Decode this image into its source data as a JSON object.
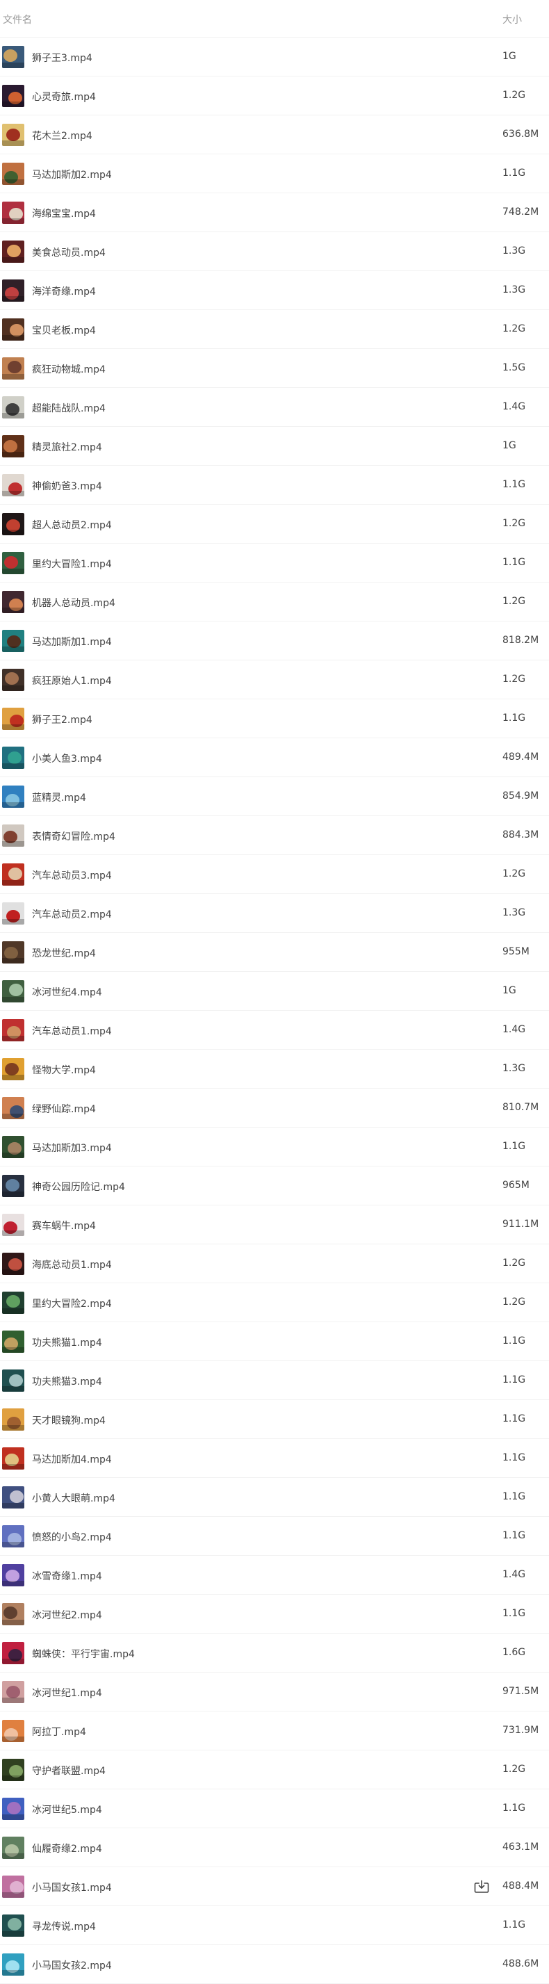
{
  "header": {
    "name_label": "文件名",
    "size_label": "大小"
  },
  "files": [
    {
      "name": "狮子王3.mp4",
      "size": "1G",
      "colors": [
        "#3a5a7a",
        "#c8a060"
      ],
      "icon": "video-thumbnail-icon"
    },
    {
      "name": "心灵奇旅.mp4",
      "size": "1.2G",
      "colors": [
        "#2a1a30",
        "#d06030"
      ],
      "icon": "video-thumbnail-icon"
    },
    {
      "name": "花木兰2.mp4",
      "size": "636.8M",
      "colors": [
        "#e0c070",
        "#a03020"
      ],
      "icon": "video-thumbnail-icon"
    },
    {
      "name": "马达加斯加2.mp4",
      "size": "1.1G",
      "colors": [
        "#c07040",
        "#406030"
      ],
      "icon": "video-thumbnail-icon"
    },
    {
      "name": "海绵宝宝.mp4",
      "size": "748.2M",
      "colors": [
        "#b03040",
        "#e0d0c0"
      ],
      "icon": "video-thumbnail-icon"
    },
    {
      "name": "美食总动员.mp4",
      "size": "1.3G",
      "colors": [
        "#602020",
        "#e0a060"
      ],
      "icon": "video-thumbnail-icon"
    },
    {
      "name": "海洋奇缘.mp4",
      "size": "1.3G",
      "colors": [
        "#302028",
        "#c04040"
      ],
      "icon": "video-thumbnail-icon"
    },
    {
      "name": "宝贝老板.mp4",
      "size": "1.2G",
      "colors": [
        "#503020",
        "#d09060"
      ],
      "icon": "video-thumbnail-icon"
    },
    {
      "name": "疯狂动物城.mp4",
      "size": "1.5G",
      "colors": [
        "#c08050",
        "#704030"
      ],
      "icon": "video-thumbnail-icon"
    },
    {
      "name": "超能陆战队.mp4",
      "size": "1.4G",
      "colors": [
        "#d0d0c8",
        "#404040"
      ],
      "icon": "video-thumbnail-icon"
    },
    {
      "name": "精灵旅社2.mp4",
      "size": "1G",
      "colors": [
        "#603018",
        "#c07040"
      ],
      "icon": "video-thumbnail-icon"
    },
    {
      "name": "神偷奶爸3.mp4",
      "size": "1.1G",
      "colors": [
        "#e0d8d0",
        "#c03030"
      ],
      "icon": "video-thumbnail-icon"
    },
    {
      "name": "超人总动员2.mp4",
      "size": "1.2G",
      "colors": [
        "#201818",
        "#c04030"
      ],
      "icon": "video-thumbnail-icon"
    },
    {
      "name": "里约大冒险1.mp4",
      "size": "1.1G",
      "colors": [
        "#306040",
        "#c03030"
      ],
      "icon": "video-thumbnail-icon"
    },
    {
      "name": "机器人总动员.mp4",
      "size": "1.2G",
      "colors": [
        "#402830",
        "#d08050"
      ],
      "icon": "video-thumbnail-icon"
    },
    {
      "name": "马达加斯加1.mp4",
      "size": "818.2M",
      "colors": [
        "#208080",
        "#503020"
      ],
      "icon": "video-thumbnail-icon"
    },
    {
      "name": "疯狂原始人1.mp4",
      "size": "1.2G",
      "colors": [
        "#403028",
        "#a07050"
      ],
      "icon": "video-thumbnail-icon"
    },
    {
      "name": "狮子王2.mp4",
      "size": "1.1G",
      "colors": [
        "#e0a040",
        "#c03020"
      ],
      "icon": "video-thumbnail-icon"
    },
    {
      "name": "小美人鱼3.mp4",
      "size": "489.4M",
      "colors": [
        "#207080",
        "#30a090"
      ],
      "icon": "video-thumbnail-icon"
    },
    {
      "name": "蓝精灵.mp4",
      "size": "854.9M",
      "colors": [
        "#3080c0",
        "#80c0e0"
      ],
      "icon": "video-thumbnail-icon"
    },
    {
      "name": "表情奇幻冒险.mp4",
      "size": "884.3M",
      "colors": [
        "#d0c8c0",
        "#804030"
      ],
      "icon": "video-thumbnail-icon"
    },
    {
      "name": "汽车总动员3.mp4",
      "size": "1.2G",
      "colors": [
        "#c03020",
        "#e0c0a0"
      ],
      "icon": "video-thumbnail-icon"
    },
    {
      "name": "汽车总动员2.mp4",
      "size": "1.3G",
      "colors": [
        "#e0e0e0",
        "#c02020"
      ],
      "icon": "video-thumbnail-icon"
    },
    {
      "name": "恐龙世纪.mp4",
      "size": "955M",
      "colors": [
        "#503828",
        "#806040"
      ],
      "icon": "video-thumbnail-icon"
    },
    {
      "name": "冰河世纪4.mp4",
      "size": "1G",
      "colors": [
        "#406040",
        "#a0c0a0"
      ],
      "icon": "video-thumbnail-icon"
    },
    {
      "name": "汽车总动员1.mp4",
      "size": "1.4G",
      "colors": [
        "#c03030",
        "#d09060"
      ],
      "icon": "video-thumbnail-icon"
    },
    {
      "name": "怪物大学.mp4",
      "size": "1.3G",
      "colors": [
        "#e0a030",
        "#804020"
      ],
      "icon": "video-thumbnail-icon"
    },
    {
      "name": "绿野仙踪.mp4",
      "size": "810.7M",
      "colors": [
        "#d08050",
        "#405070"
      ],
      "icon": "video-thumbnail-icon"
    },
    {
      "name": "马达加斯加3.mp4",
      "size": "1.1G",
      "colors": [
        "#305030",
        "#a08060"
      ],
      "icon": "video-thumbnail-icon"
    },
    {
      "name": "神奇公园历险记.mp4",
      "size": "965M",
      "colors": [
        "#283040",
        "#6080a0"
      ],
      "icon": "video-thumbnail-icon"
    },
    {
      "name": "赛车蜗牛.mp4",
      "size": "911.1M",
      "colors": [
        "#e8e0e0",
        "#c02030"
      ],
      "icon": "video-thumbnail-icon"
    },
    {
      "name": "海底总动员1.mp4",
      "size": "1.2G",
      "colors": [
        "#301818",
        "#c05040"
      ],
      "icon": "video-thumbnail-icon"
    },
    {
      "name": "里约大冒险2.mp4",
      "size": "1.2G",
      "colors": [
        "#204030",
        "#60a060"
      ],
      "icon": "video-thumbnail-icon"
    },
    {
      "name": "功夫熊猫1.mp4",
      "size": "1.1G",
      "colors": [
        "#306030",
        "#c0a060"
      ],
      "icon": "video-thumbnail-icon"
    },
    {
      "name": "功夫熊猫3.mp4",
      "size": "1.1G",
      "colors": [
        "#205050",
        "#a0c0c0"
      ],
      "icon": "video-thumbnail-icon"
    },
    {
      "name": "天才眼镜狗.mp4",
      "size": "1.1G",
      "colors": [
        "#e0a040",
        "#a06030"
      ],
      "icon": "video-thumbnail-icon"
    },
    {
      "name": "马达加斯加4.mp4",
      "size": "1.1G",
      "colors": [
        "#c03020",
        "#e0c080"
      ],
      "icon": "video-thumbnail-icon"
    },
    {
      "name": "小黄人大眼萌.mp4",
      "size": "1.1G",
      "colors": [
        "#405080",
        "#c0c0d0"
      ],
      "icon": "video-thumbnail-icon"
    },
    {
      "name": "愤怒的小鸟2.mp4",
      "size": "1.1G",
      "colors": [
        "#6070c0",
        "#a0b0e0"
      ],
      "icon": "video-thumbnail-icon"
    },
    {
      "name": "冰雪奇缘1.mp4",
      "size": "1.4G",
      "colors": [
        "#5040a0",
        "#c0a0e0"
      ],
      "icon": "video-thumbnail-icon"
    },
    {
      "name": "冰河世纪2.mp4",
      "size": "1.1G",
      "colors": [
        "#b08060",
        "#604030"
      ],
      "icon": "video-thumbnail-icon"
    },
    {
      "name": "蜘蛛侠：平行宇宙.mp4",
      "size": "1.6G",
      "colors": [
        "#c02040",
        "#402040"
      ],
      "icon": "video-thumbnail-icon"
    },
    {
      "name": "冰河世纪1.mp4",
      "size": "971.5M",
      "colors": [
        "#d0a0a0",
        "#a06070"
      ],
      "icon": "video-thumbnail-icon"
    },
    {
      "name": "阿拉丁.mp4",
      "size": "731.9M",
      "colors": [
        "#e08040",
        "#f0c0a0"
      ],
      "icon": "video-thumbnail-icon"
    },
    {
      "name": "守护者联盟.mp4",
      "size": "1.2G",
      "colors": [
        "#304020",
        "#80a060"
      ],
      "icon": "video-thumbnail-icon"
    },
    {
      "name": "冰河世纪5.mp4",
      "size": "1.1G",
      "colors": [
        "#4060c0",
        "#a070c0"
      ],
      "icon": "video-thumbnail-icon"
    },
    {
      "name": "仙履奇缘2.mp4",
      "size": "463.1M",
      "colors": [
        "#608060",
        "#b0c0a0"
      ],
      "icon": "video-thumbnail-icon"
    },
    {
      "name": "小马国女孩1.mp4",
      "size": "488.4M",
      "colors": [
        "#c070a0",
        "#e0b0d0"
      ],
      "icon": "video-thumbnail-icon",
      "download": true
    },
    {
      "name": "寻龙传说.mp4",
      "size": "1.1G",
      "colors": [
        "#205050",
        "#80b0a0"
      ],
      "icon": "video-thumbnail-icon"
    },
    {
      "name": "小马国女孩2.mp4",
      "size": "488.6M",
      "colors": [
        "#30a0c0",
        "#a0e0f0"
      ],
      "icon": "video-thumbnail-icon"
    }
  ],
  "download_icon": "download-icon"
}
